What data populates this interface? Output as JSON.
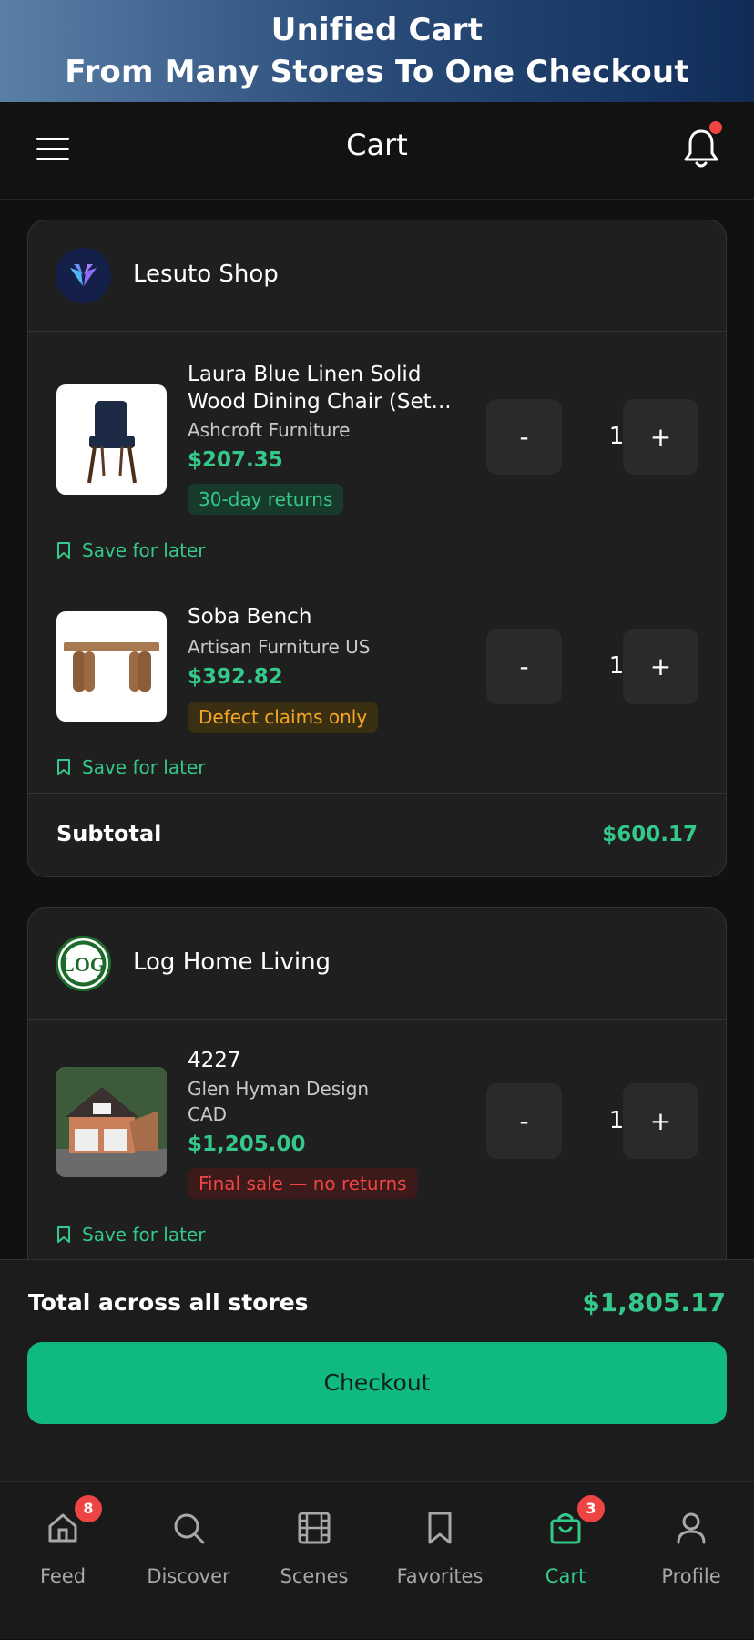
{
  "banner": {
    "line1": "Unified Cart",
    "line2": "From Many Stores To One Checkout"
  },
  "header": {
    "title": "Cart",
    "menu_icon": "hamburger-icon",
    "bell_icon": "bell-icon"
  },
  "stores": [
    {
      "name": "Lesuto Shop",
      "items": [
        {
          "title_line1": "Laura  Blue Linen Solid",
          "title_line2": "Wood Dining Chair (Set...",
          "seller": "Ashcroft Furniture",
          "price": "$207.35",
          "badge": "30-day returns",
          "qty": "1",
          "save": "Save for later"
        },
        {
          "title_line1": "Soba Bench",
          "seller": "Artisan Furniture US",
          "price": "$392.82",
          "badge": "Defect claims only",
          "qty": "1",
          "save": "Save for later"
        }
      ],
      "subtotal_label": "Subtotal",
      "subtotal": "$600.17"
    },
    {
      "name": "Log Home Living",
      "logo_text": "LOG",
      "items": [
        {
          "title_line1": "4227",
          "seller": "Glen Hyman Design",
          "seller2": "CAD",
          "price": "$1,205.00",
          "badge": "Final sale — no returns",
          "qty": "1",
          "save": "Save for later"
        }
      ]
    }
  ],
  "qty_controls": {
    "minus": "-",
    "plus": "+"
  },
  "totals": {
    "label": "Total across all stores",
    "value": "$1,805.17",
    "checkout": "Checkout"
  },
  "tabs": [
    {
      "label": "Feed",
      "icon": "home-icon",
      "badge": "8"
    },
    {
      "label": "Discover",
      "icon": "search-icon"
    },
    {
      "label": "Scenes",
      "icon": "film-icon"
    },
    {
      "label": "Favorites",
      "icon": "bookmark-icon"
    },
    {
      "label": "Cart",
      "icon": "cart-icon",
      "badge": "3",
      "active": true
    },
    {
      "label": "Profile",
      "icon": "user-icon"
    }
  ],
  "colors": {
    "accent": "#10b981",
    "price": "#34c98a",
    "danger": "#ef4444",
    "warning": "#f5a623"
  }
}
